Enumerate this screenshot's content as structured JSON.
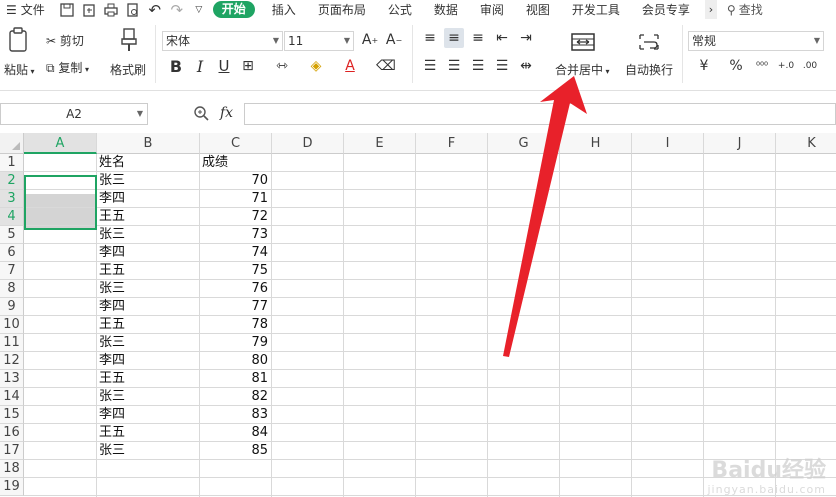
{
  "menubar": {
    "file": "文件",
    "tabs": [
      "开始",
      "插入",
      "页面布局",
      "公式",
      "数据",
      "审阅",
      "视图",
      "开发工具",
      "会员专享"
    ],
    "search": "查找"
  },
  "ribbon": {
    "paste": "粘贴",
    "cut": "剪切",
    "copy": "复制",
    "format_painter": "格式刷",
    "font_name": "宋体",
    "font_size": "11",
    "merge_center": "合并居中",
    "wrap_text": "自动换行",
    "number_format": "常规"
  },
  "formula": {
    "name_box": "A2",
    "fx": "fx",
    "value": ""
  },
  "columns": [
    "A",
    "B",
    "C",
    "D",
    "E",
    "F",
    "G",
    "H",
    "I",
    "J",
    "K"
  ],
  "rows": [
    "1",
    "2",
    "3",
    "4",
    "5",
    "6",
    "7",
    "8",
    "9",
    "10",
    "11",
    "12",
    "13",
    "14",
    "15",
    "16",
    "17",
    "18",
    "19"
  ],
  "sheet": {
    "B1": "姓名",
    "C1": "成绩",
    "B2": "张三",
    "C2": "70",
    "B3": "李四",
    "C3": "71",
    "B4": "王五",
    "C4": "72",
    "B5": "张三",
    "C5": "73",
    "B6": "李四",
    "C6": "74",
    "B7": "王五",
    "C7": "75",
    "B8": "张三",
    "C8": "76",
    "B9": "李四",
    "C9": "77",
    "B10": "王五",
    "C10": "78",
    "B11": "张三",
    "C11": "79",
    "B12": "李四",
    "C12": "80",
    "B13": "王五",
    "C13": "81",
    "B14": "张三",
    "C14": "82",
    "B15": "李四",
    "C15": "83",
    "B16": "王五",
    "C16": "84",
    "B17": "张三",
    "C17": "85"
  },
  "colors": {
    "accent": "#1fa463",
    "arrow": "#e8212a"
  },
  "watermark": {
    "brand": "Baidu经验",
    "url": "jingyan.baidu.com"
  }
}
